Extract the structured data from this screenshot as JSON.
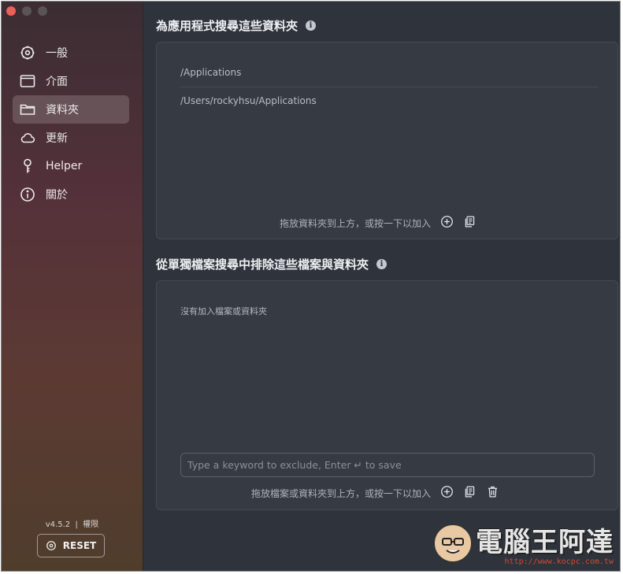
{
  "sidebar": {
    "items": [
      {
        "label": "一般",
        "icon": "gear-icon",
        "active": false
      },
      {
        "label": "介面",
        "icon": "window-icon",
        "active": false
      },
      {
        "label": "資料夾",
        "icon": "folder-icon",
        "active": true
      },
      {
        "label": "更新",
        "icon": "cloud-icon",
        "active": false
      },
      {
        "label": "Helper",
        "icon": "key-icon",
        "active": false
      },
      {
        "label": "關於",
        "icon": "info-icon",
        "active": false
      }
    ],
    "version": "v4.5.2",
    "separator": "|",
    "permissions": "權限",
    "reset_label": "RESET"
  },
  "search_folders": {
    "title": "為應用程式搜尋這些資料夾",
    "paths": [
      "/Applications",
      "/Users/rockyhsu/Applications"
    ],
    "hint": "拖放資料夾到上方，或按一下以加入"
  },
  "exclude": {
    "title": "從單獨檔案搜尋中排除這些檔案與資料夾",
    "empty": "沒有加入檔案或資料夾",
    "input_placeholder": "Type a keyword to exclude, Enter ↵ to save",
    "hint": "拖放檔案或資料夾到上方，或按一下以加入"
  },
  "watermark": {
    "title": "電腦王阿達",
    "url": "http://www.kocpc.com.tw"
  },
  "colors": {
    "accent_red": "#ec5f5a",
    "main_bg": "#2f333c",
    "panel_bg": "#353a43"
  }
}
